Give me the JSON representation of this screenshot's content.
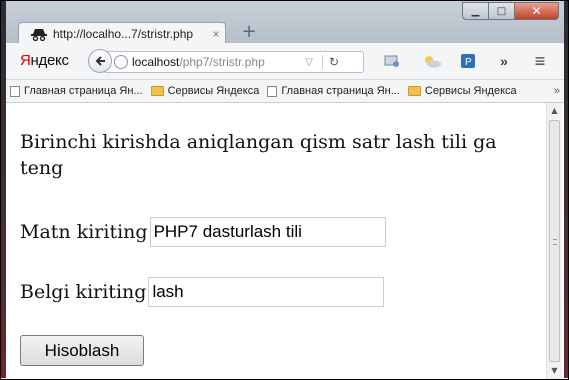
{
  "browser": {
    "tab": {
      "title": "http://localho...7/stristr.php",
      "close_label": "×"
    },
    "new_tab_label": "+",
    "window_controls": {
      "minimize": "▁",
      "maximize": "□",
      "close": "✕"
    },
    "logo": {
      "first_letter": "Я",
      "rest": "ндекс"
    },
    "url": {
      "host": "localhost",
      "path": "/php7/stristr.php"
    },
    "nav_icons": {
      "more": "»",
      "menu": "≡"
    },
    "bookmarks": [
      {
        "label": "Главная страница Ян...",
        "icon": "page-icon"
      },
      {
        "label": "Сервисы Яндекса",
        "icon": "folder-icon"
      },
      {
        "label": "Главная страница Ян...",
        "icon": "page-icon"
      },
      {
        "label": "Сервисы Яндекса",
        "icon": "folder-icon"
      }
    ],
    "bookmarks_more": "»"
  },
  "page": {
    "headline": "Birinchi kirishda aniqlangan qism satr lash tili ga teng",
    "text_field": {
      "label": "Matn kiriting",
      "value": "PHP7 dasturlash tili"
    },
    "char_field": {
      "label": "Belgi kiriting",
      "value": "lash"
    },
    "submit_label": "Hisoblash"
  },
  "colors": {
    "accent_red": "#e60000",
    "titlebar": "#c2cad4",
    "close_button": "#c2402c"
  }
}
